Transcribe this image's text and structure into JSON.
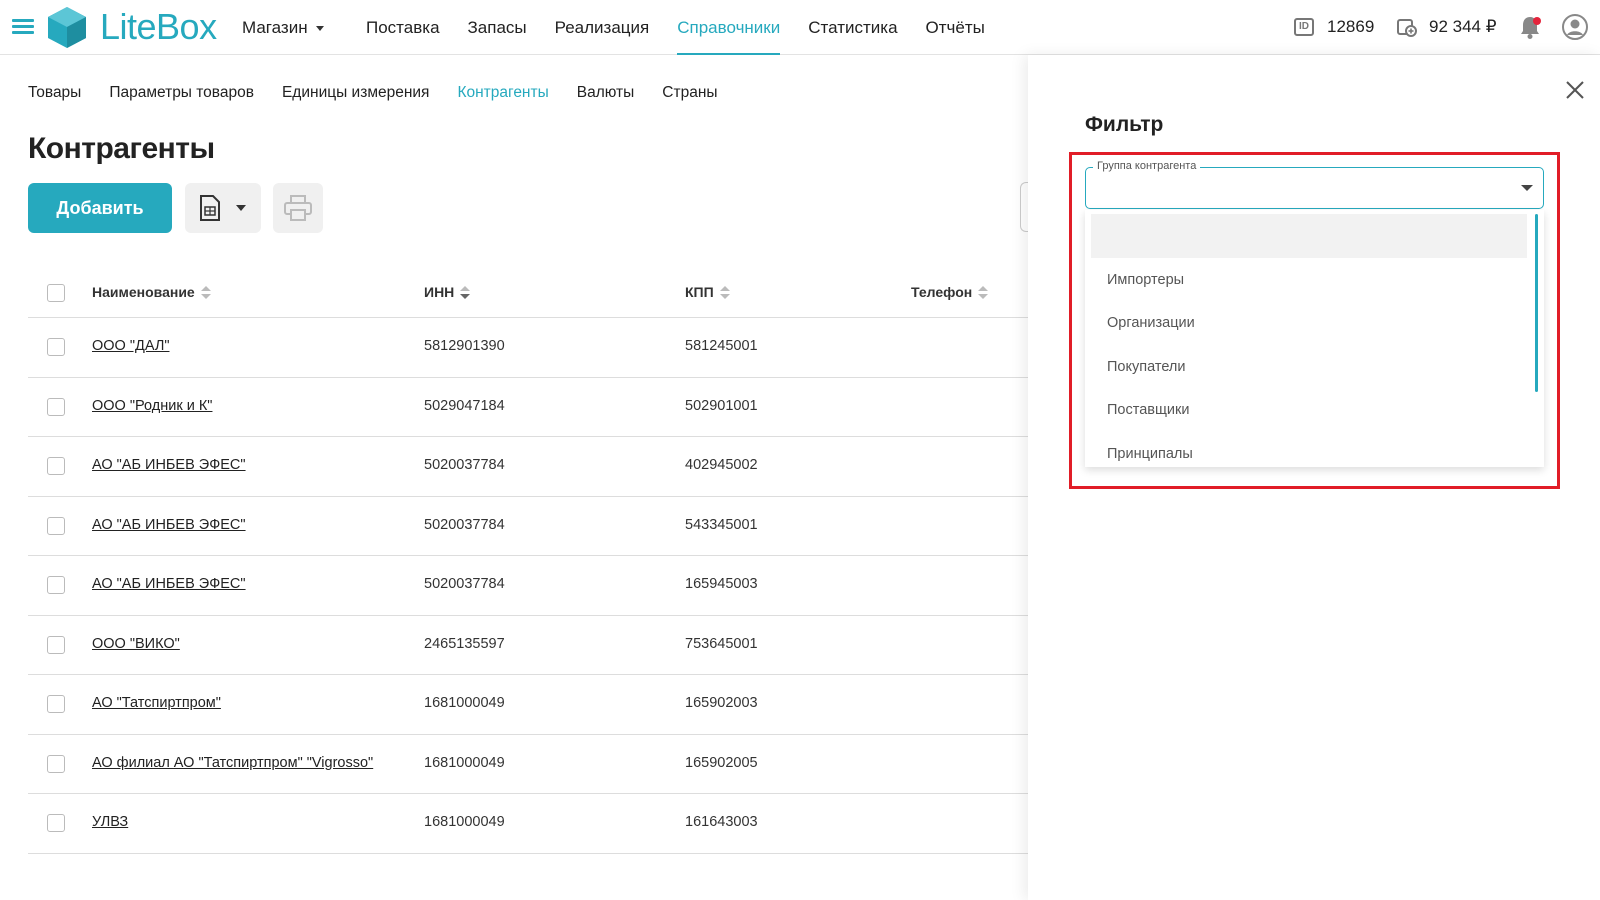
{
  "brand": {
    "name": "LiteBox",
    "accent": "#26a9be"
  },
  "header": {
    "store": "Магазин",
    "nav": [
      "Поставка",
      "Запасы",
      "Реализация",
      "Справочники",
      "Статистика",
      "Отчёты"
    ],
    "active_nav": "Справочники",
    "user_id": "12869",
    "balance": "92 344 ₽"
  },
  "subnav": {
    "items": [
      "Товары",
      "Параметры товаров",
      "Единицы измерения",
      "Контрагенты",
      "Валюты",
      "Страны"
    ],
    "active": "Контрагенты"
  },
  "page": {
    "title": "Контрагенты",
    "add_label": "Добавить"
  },
  "table": {
    "columns": [
      "Наименование",
      "ИНН",
      "КПП",
      "Телефон"
    ],
    "rows": [
      {
        "name": "ООО \"ДАЛ\"",
        "inn": "5812901390",
        "kpp": "581245001"
      },
      {
        "name": "ООО \"Родник и К\"",
        "inn": "5029047184",
        "kpp": "502901001"
      },
      {
        "name": "АО \"АБ ИНБЕВ ЭФЕС\"",
        "inn": "5020037784",
        "kpp": "402945002"
      },
      {
        "name": "АО \"АБ ИНБЕВ ЭФЕС\"",
        "inn": "5020037784",
        "kpp": "543345001"
      },
      {
        "name": "АО \"АБ ИНБЕВ ЭФЕС\"",
        "inn": "5020037784",
        "kpp": "165945003"
      },
      {
        "name": "ООО \"ВИКО\"",
        "inn": "2465135597",
        "kpp": "753645001"
      },
      {
        "name": "АО \"Татспиртпром\"",
        "inn": "1681000049",
        "kpp": "165902003"
      },
      {
        "name": "АО филиал АО \"Татспиртпром\" \"Vigrosso\"",
        "inn": "1681000049",
        "kpp": "165902005"
      },
      {
        "name": "УЛВЗ",
        "inn": "1681000049",
        "kpp": "161643003"
      }
    ]
  },
  "filter": {
    "title": "Фильтр",
    "group_label": "Группа контрагента",
    "options": [
      "Импортеры",
      "Организации",
      "Покупатели",
      "Поставщики",
      "Принципалы"
    ],
    "highlight_color": "#e11d27"
  }
}
